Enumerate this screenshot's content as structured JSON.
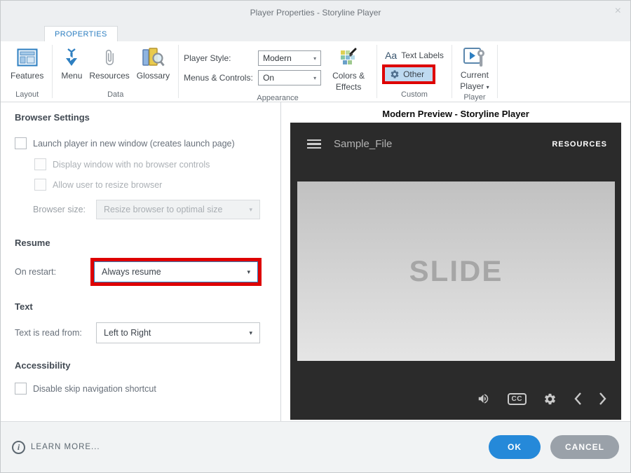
{
  "window": {
    "title": "Player Properties - Storyline Player"
  },
  "icons": {
    "close": "×",
    "caret": "▾",
    "cc": "CC",
    "info": "i"
  },
  "tabs": {
    "properties": "PROPERTIES"
  },
  "ribbon": {
    "layout": {
      "group": "Layout",
      "features": "Features"
    },
    "data": {
      "group": "Data",
      "menu": "Menu",
      "resources": "Resources",
      "glossary": "Glossary"
    },
    "appearance": {
      "group": "Appearance",
      "player_style_label": "Player Style:",
      "player_style_value": "Modern",
      "menus_controls_label": "Menus & Controls:",
      "menus_controls_value": "On",
      "colors_effects": "Colors & Effects"
    },
    "custom": {
      "group": "Custom",
      "aa": "Aa",
      "text_labels": "Text Labels",
      "other": "Other"
    },
    "player": {
      "group": "Player",
      "current_player": "Current Player"
    }
  },
  "settings": {
    "browser": {
      "heading": "Browser Settings",
      "launch": "Launch player in new window (creates launch page)",
      "no_controls": "Display window with no browser controls",
      "allow_resize": "Allow user to resize browser",
      "size_label": "Browser size:",
      "size_value": "Resize browser to optimal size"
    },
    "resume": {
      "heading": "Resume",
      "restart_label": "On restart:",
      "restart_value": "Always resume"
    },
    "text": {
      "heading": "Text",
      "read_label": "Text is read from:",
      "read_value": "Left to Right"
    },
    "accessibility": {
      "heading": "Accessibility",
      "skip_nav": "Disable skip navigation shortcut"
    }
  },
  "preview": {
    "title": "Modern Preview - Storyline Player",
    "file_title": "Sample_File",
    "resources": "RESOURCES",
    "slide": "SLIDE"
  },
  "footer": {
    "learn_more": "LEARN MORE...",
    "ok": "OK",
    "cancel": "CANCEL"
  },
  "colors": {
    "accent_blue": "#2e7fc1",
    "highlight_red": "#de0000",
    "other_highlight": "#bedaf1",
    "ok_blue": "#2589d9",
    "cancel_gray": "#9aa1a9",
    "preview_bg": "#2b2b2b"
  }
}
